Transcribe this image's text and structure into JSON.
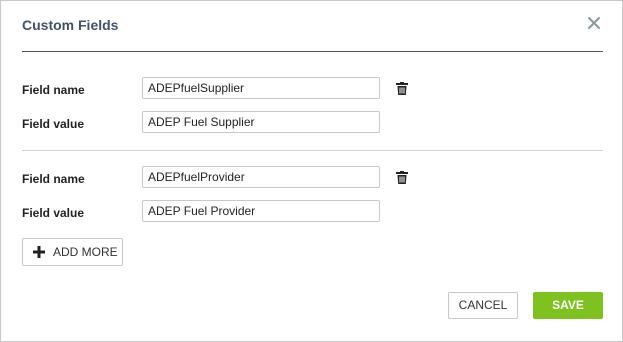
{
  "dialog": {
    "title": "Custom Fields",
    "close_icon": "close-icon"
  },
  "fields": [
    {
      "name_label": "Field name",
      "name_value": "ADEPfuelSupplier",
      "value_label": "Field value",
      "value_value": "ADEP Fuel Supplier",
      "delete_icon": "trash-icon"
    },
    {
      "name_label": "Field name",
      "name_value": "ADEPfuelProvider",
      "value_label": "Field value",
      "value_value": "ADEP Fuel Provider",
      "delete_icon": "trash-icon"
    }
  ],
  "actions": {
    "add_more_label": "ADD MORE",
    "cancel_label": "CANCEL",
    "save_label": "SAVE"
  },
  "colors": {
    "title": "#3f5468",
    "save_button": "#7dc21e",
    "header_rule": "#4a5560"
  }
}
